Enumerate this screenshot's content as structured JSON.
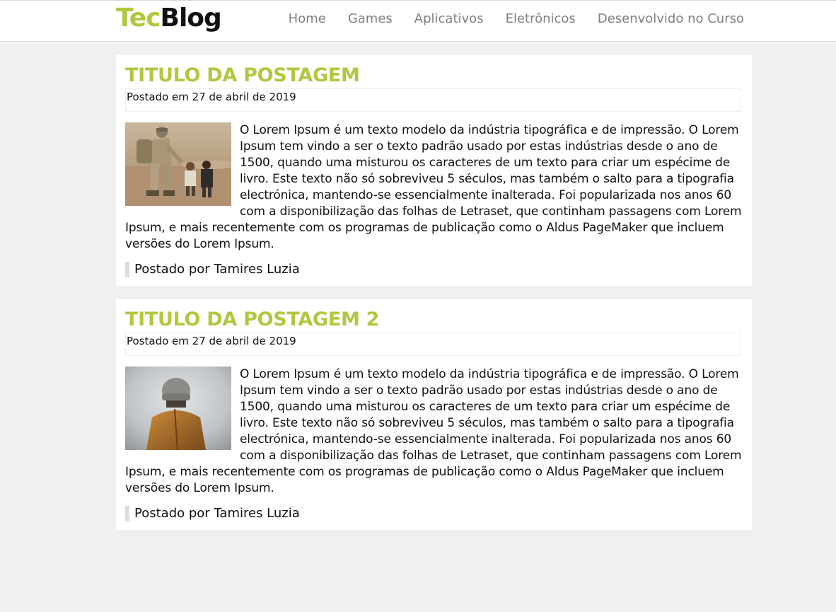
{
  "brand": {
    "part1": "Tec",
    "part2": "Blog",
    "accent_color": "#b4c640"
  },
  "nav": {
    "items": [
      {
        "label": "Home"
      },
      {
        "label": "Games"
      },
      {
        "label": "Aplicativos"
      },
      {
        "label": "Eletrônicos"
      },
      {
        "label": "Desenvolvido no Curso"
      }
    ]
  },
  "posts": [
    {
      "title": "TITULO DA POSTAGEM",
      "date": "Postado em 27 de abril de 2019",
      "image": "soldier-with-child-photo",
      "body": "O Lorem Ipsum é um texto modelo da indústria tipográfica e de impressão. O Lorem Ipsum tem vindo a ser o texto padrão usado por estas indústrias desde o ano de 1500, quando uma misturou os caracteres de um texto para criar um espécime de livro. Este texto não só sobreviveu 5 séculos, mas também o salto para a tipografia electrónica, mantendo-se essencialmente inalterada. Foi popularizada nos anos 60 com a disponibilização das folhas de Letraset, que continham passagens com Lorem Ipsum, e mais recentemente com os programas de publicação como o Aldus PageMaker que incluem versões do Lorem Ipsum.",
      "author": "Postado por Tamires Luzia"
    },
    {
      "title": "TITULO DA POSTAGEM 2",
      "date": "Postado em 27 de abril de 2019",
      "image": "person-in-beanie-photo",
      "body": "O Lorem Ipsum é um texto modelo da indústria tipográfica e de impressão. O Lorem Ipsum tem vindo a ser o texto padrão usado por estas indústrias desde o ano de 1500, quando uma misturou os caracteres de um texto para criar um espécime de livro. Este texto não só sobreviveu 5 séculos, mas também o salto para a tipografia electrónica, mantendo-se essencialmente inalterada. Foi popularizada nos anos 60 com a disponibilização das folhas de Letraset, que continham passagens com Lorem Ipsum, e mais recentemente com os programas de publicação como o Aldus PageMaker que incluem versões do Lorem Ipsum.",
      "author": "Postado por Tamires Luzia"
    }
  ]
}
